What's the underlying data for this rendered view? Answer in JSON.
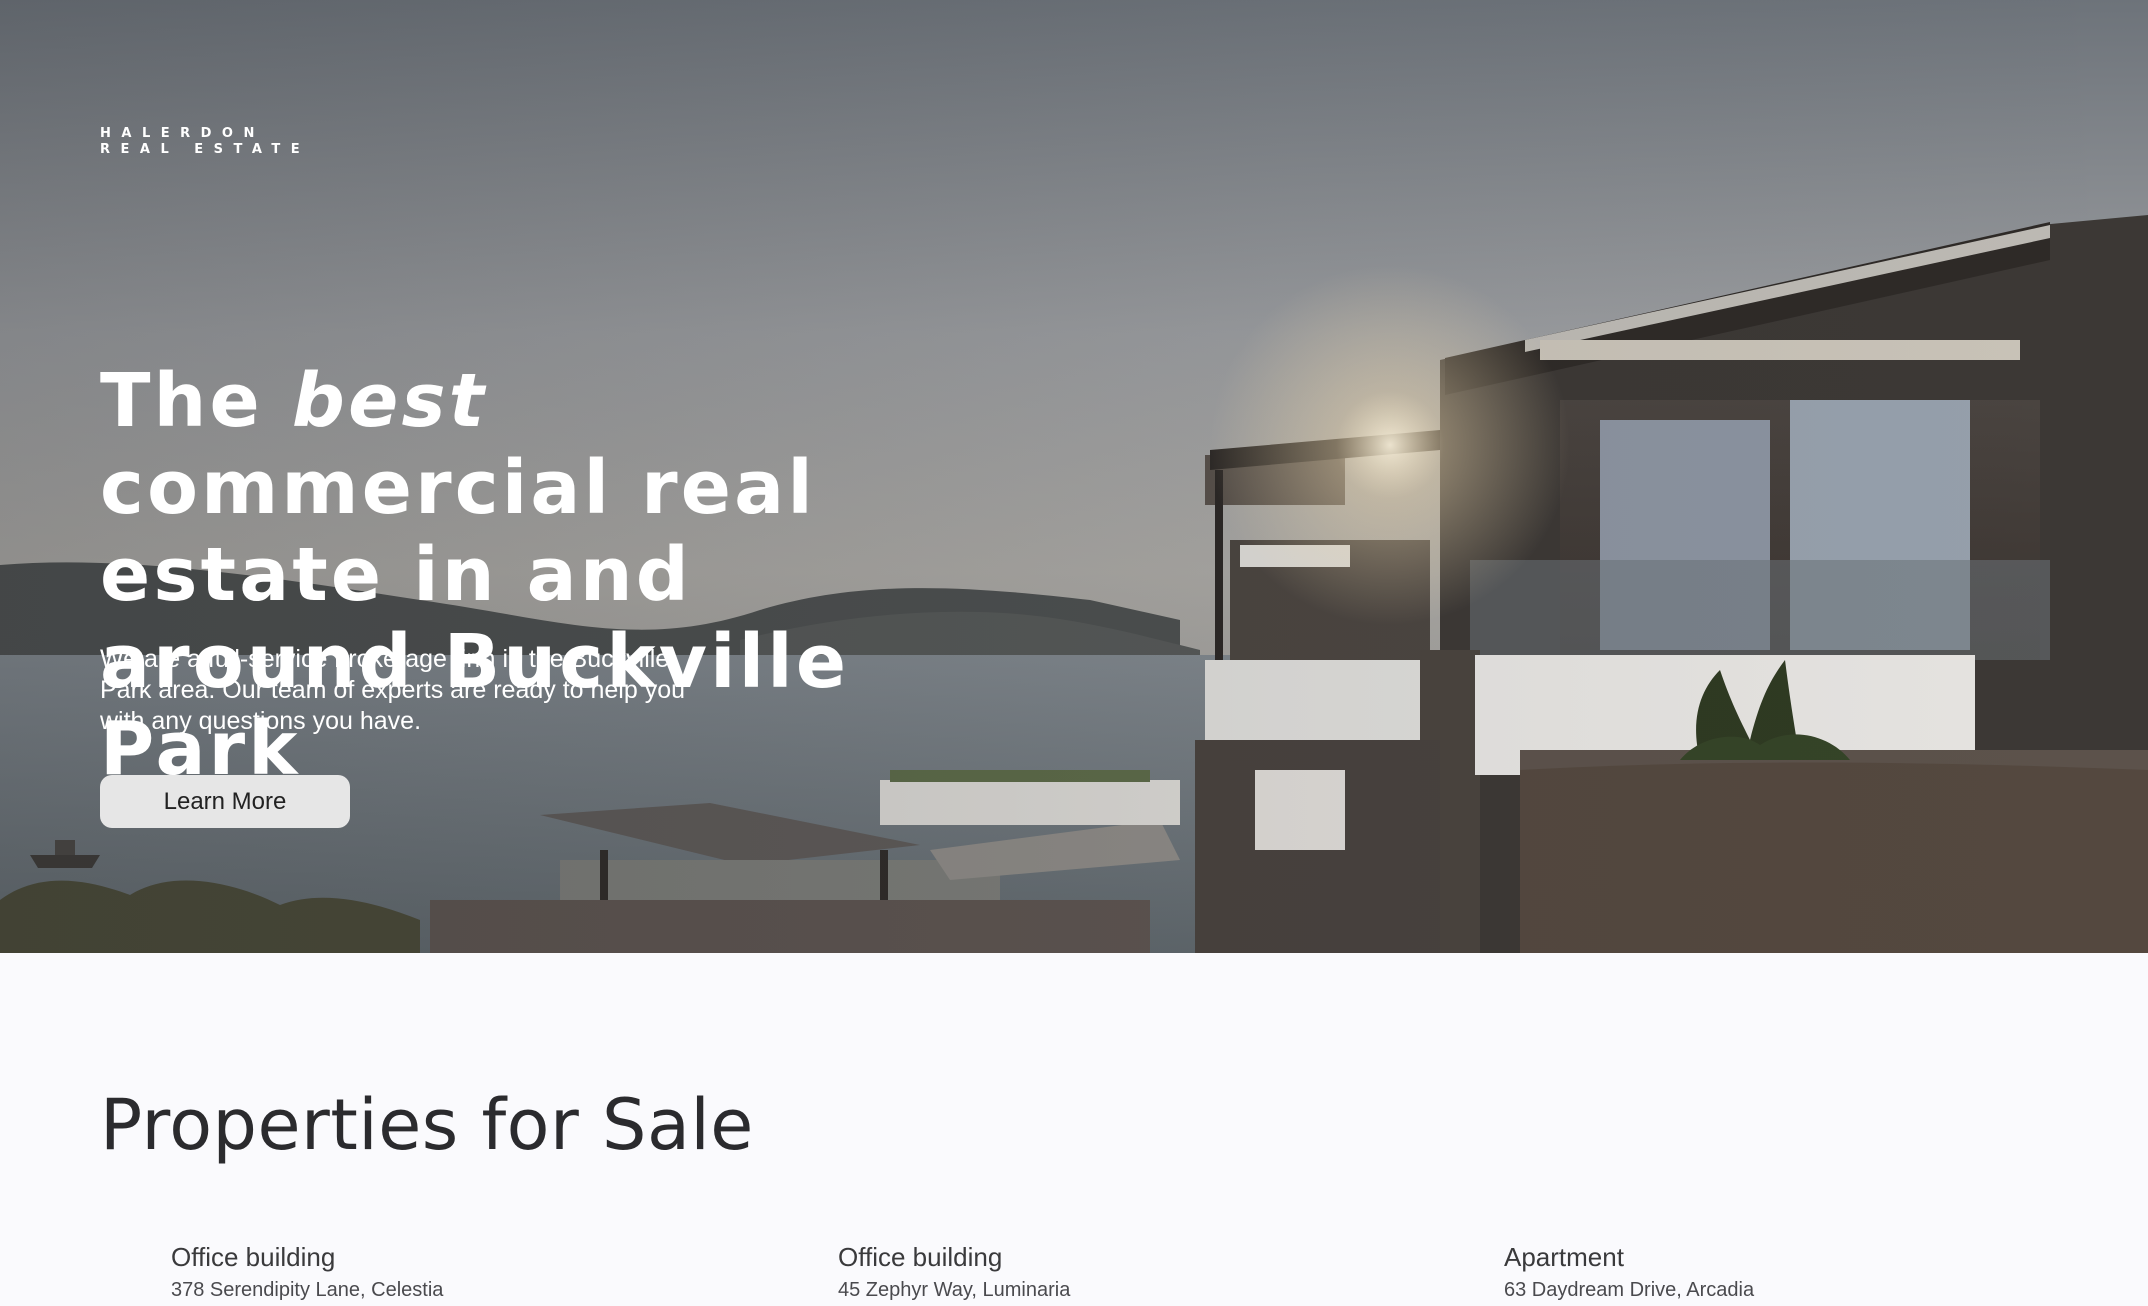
{
  "brand": {
    "line1": "HALERDON",
    "line2": "REAL ESTATE"
  },
  "hero": {
    "title_part1": "The ",
    "title_emphasis": "best",
    "title_part2": " commercial real estate in and around Buckville Park",
    "description": "We are a full-service brokerage firm in the Buckville Park area. Our team of experts are ready to help you with any questions you have.",
    "cta_label": "Learn More",
    "image": "coastal-villa-at-sunset"
  },
  "properties": {
    "heading": "Properties for Sale",
    "items": [
      {
        "type": "Office building",
        "address": "378 Serendipity Lane, Celestia"
      },
      {
        "type": "Office building",
        "address": "45 Zephyr Way, Luminaria"
      },
      {
        "type": "Apartment",
        "address": "63 Daydream Drive, Arcadia"
      }
    ]
  },
  "colors": {
    "page_background": "#fafafd",
    "hero_text": "#ffffff",
    "button_background": "#e6e6e6",
    "heading_text": "#2b2b2e"
  }
}
